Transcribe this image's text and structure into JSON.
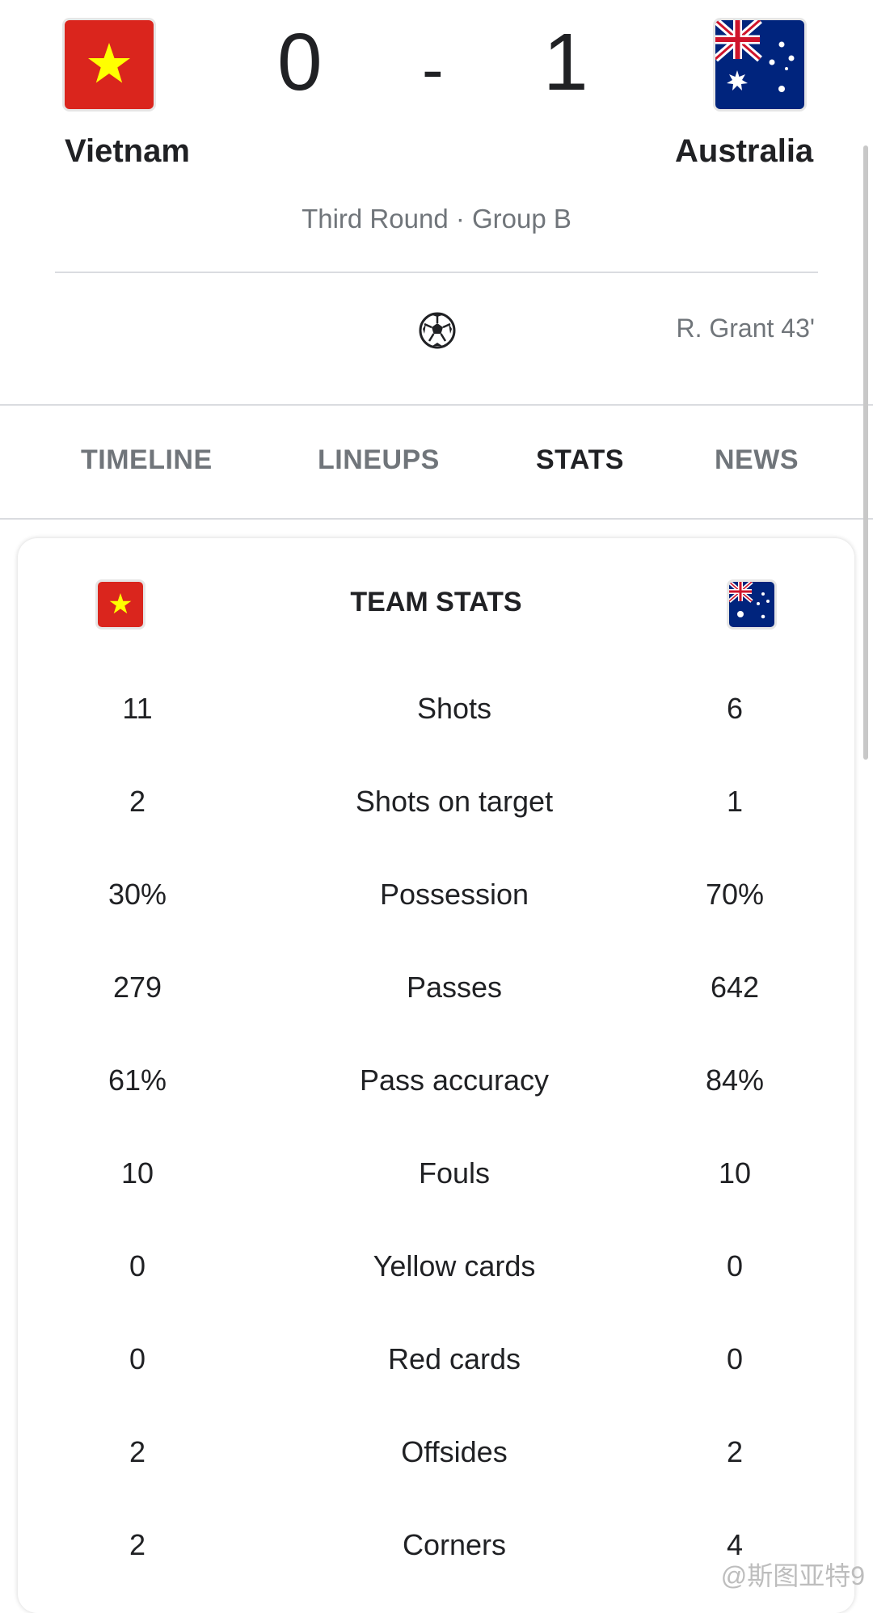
{
  "match": {
    "home": {
      "name": "Vietnam",
      "score": "0",
      "flag_icon": "vietnam-flag-icon"
    },
    "away": {
      "name": "Australia",
      "score": "1",
      "flag_icon": "australia-flag-icon"
    },
    "separator": "-",
    "round": "Third Round · Group B"
  },
  "goal": {
    "icon": "soccer-ball-icon",
    "text": "R. Grant 43'"
  },
  "tabs": [
    {
      "label": "TIMELINE",
      "active": false
    },
    {
      "label": "LINEUPS",
      "active": false
    },
    {
      "label": "STATS",
      "active": true
    },
    {
      "label": "NEWS",
      "active": false
    }
  ],
  "stats": {
    "title": "TEAM STATS",
    "rows": [
      {
        "home": "11",
        "label": "Shots",
        "away": "6"
      },
      {
        "home": "2",
        "label": "Shots on target",
        "away": "1"
      },
      {
        "home": "30%",
        "label": "Possession",
        "away": "70%"
      },
      {
        "home": "279",
        "label": "Passes",
        "away": "642"
      },
      {
        "home": "61%",
        "label": "Pass accuracy",
        "away": "84%"
      },
      {
        "home": "10",
        "label": "Fouls",
        "away": "10"
      },
      {
        "home": "0",
        "label": "Yellow cards",
        "away": "0"
      },
      {
        "home": "0",
        "label": "Red cards",
        "away": "0"
      },
      {
        "home": "2",
        "label": "Offsides",
        "away": "2"
      },
      {
        "home": "2",
        "label": "Corners",
        "away": "4"
      }
    ]
  },
  "watermark": "@斯图亚特9",
  "colors": {
    "vietnam_red": "#da251d",
    "vietnam_star": "#ffff00",
    "australia_blue": "#00247d",
    "text_primary": "#202124",
    "text_secondary": "#70757a",
    "divider": "#dadce0"
  }
}
